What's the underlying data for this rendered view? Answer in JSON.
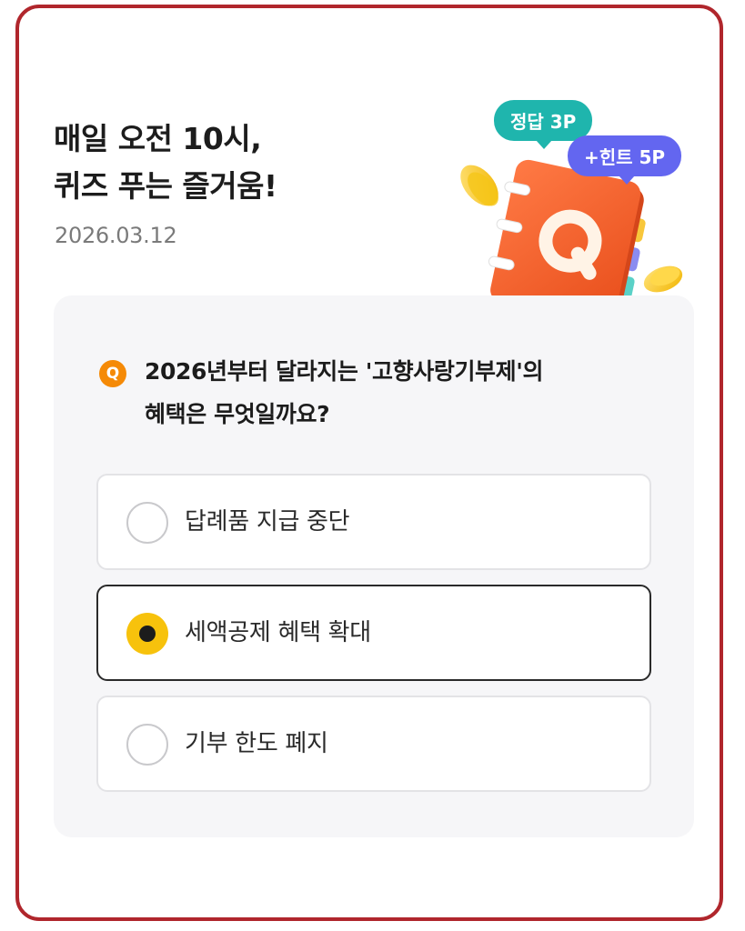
{
  "header": {
    "headline_line1": "매일 오전 10시,",
    "headline_line2": "퀴즈 푸는 즐거움!",
    "date": "2026.03.12"
  },
  "illustration": {
    "icon": "quiz-notebook-icon",
    "notebook_letter": "Q",
    "answer_bubble": "정답 3P",
    "hint_bubble": "+힌트 5P",
    "colors": {
      "notebook": "#f0602c",
      "answer_bubble": "#1fb5ad",
      "hint_bubble": "#6366f0",
      "coin": "#f5c518"
    }
  },
  "quiz": {
    "badge": "Q",
    "question_line1": "2026년부터 달라지는 '고향사랑기부제'의",
    "question_line2": "혜택은 무엇일까요?",
    "selected_index": 1,
    "options": [
      {
        "label": "답례품 지급 중단"
      },
      {
        "label": "세액공제 혜택 확대"
      },
      {
        "label": "기부 한도 폐지"
      }
    ]
  },
  "colors": {
    "frame_border": "#b0262c",
    "badge": "#f58a07",
    "selected_radio": "#f7c20c",
    "panel_bg": "#f6f6f8"
  }
}
